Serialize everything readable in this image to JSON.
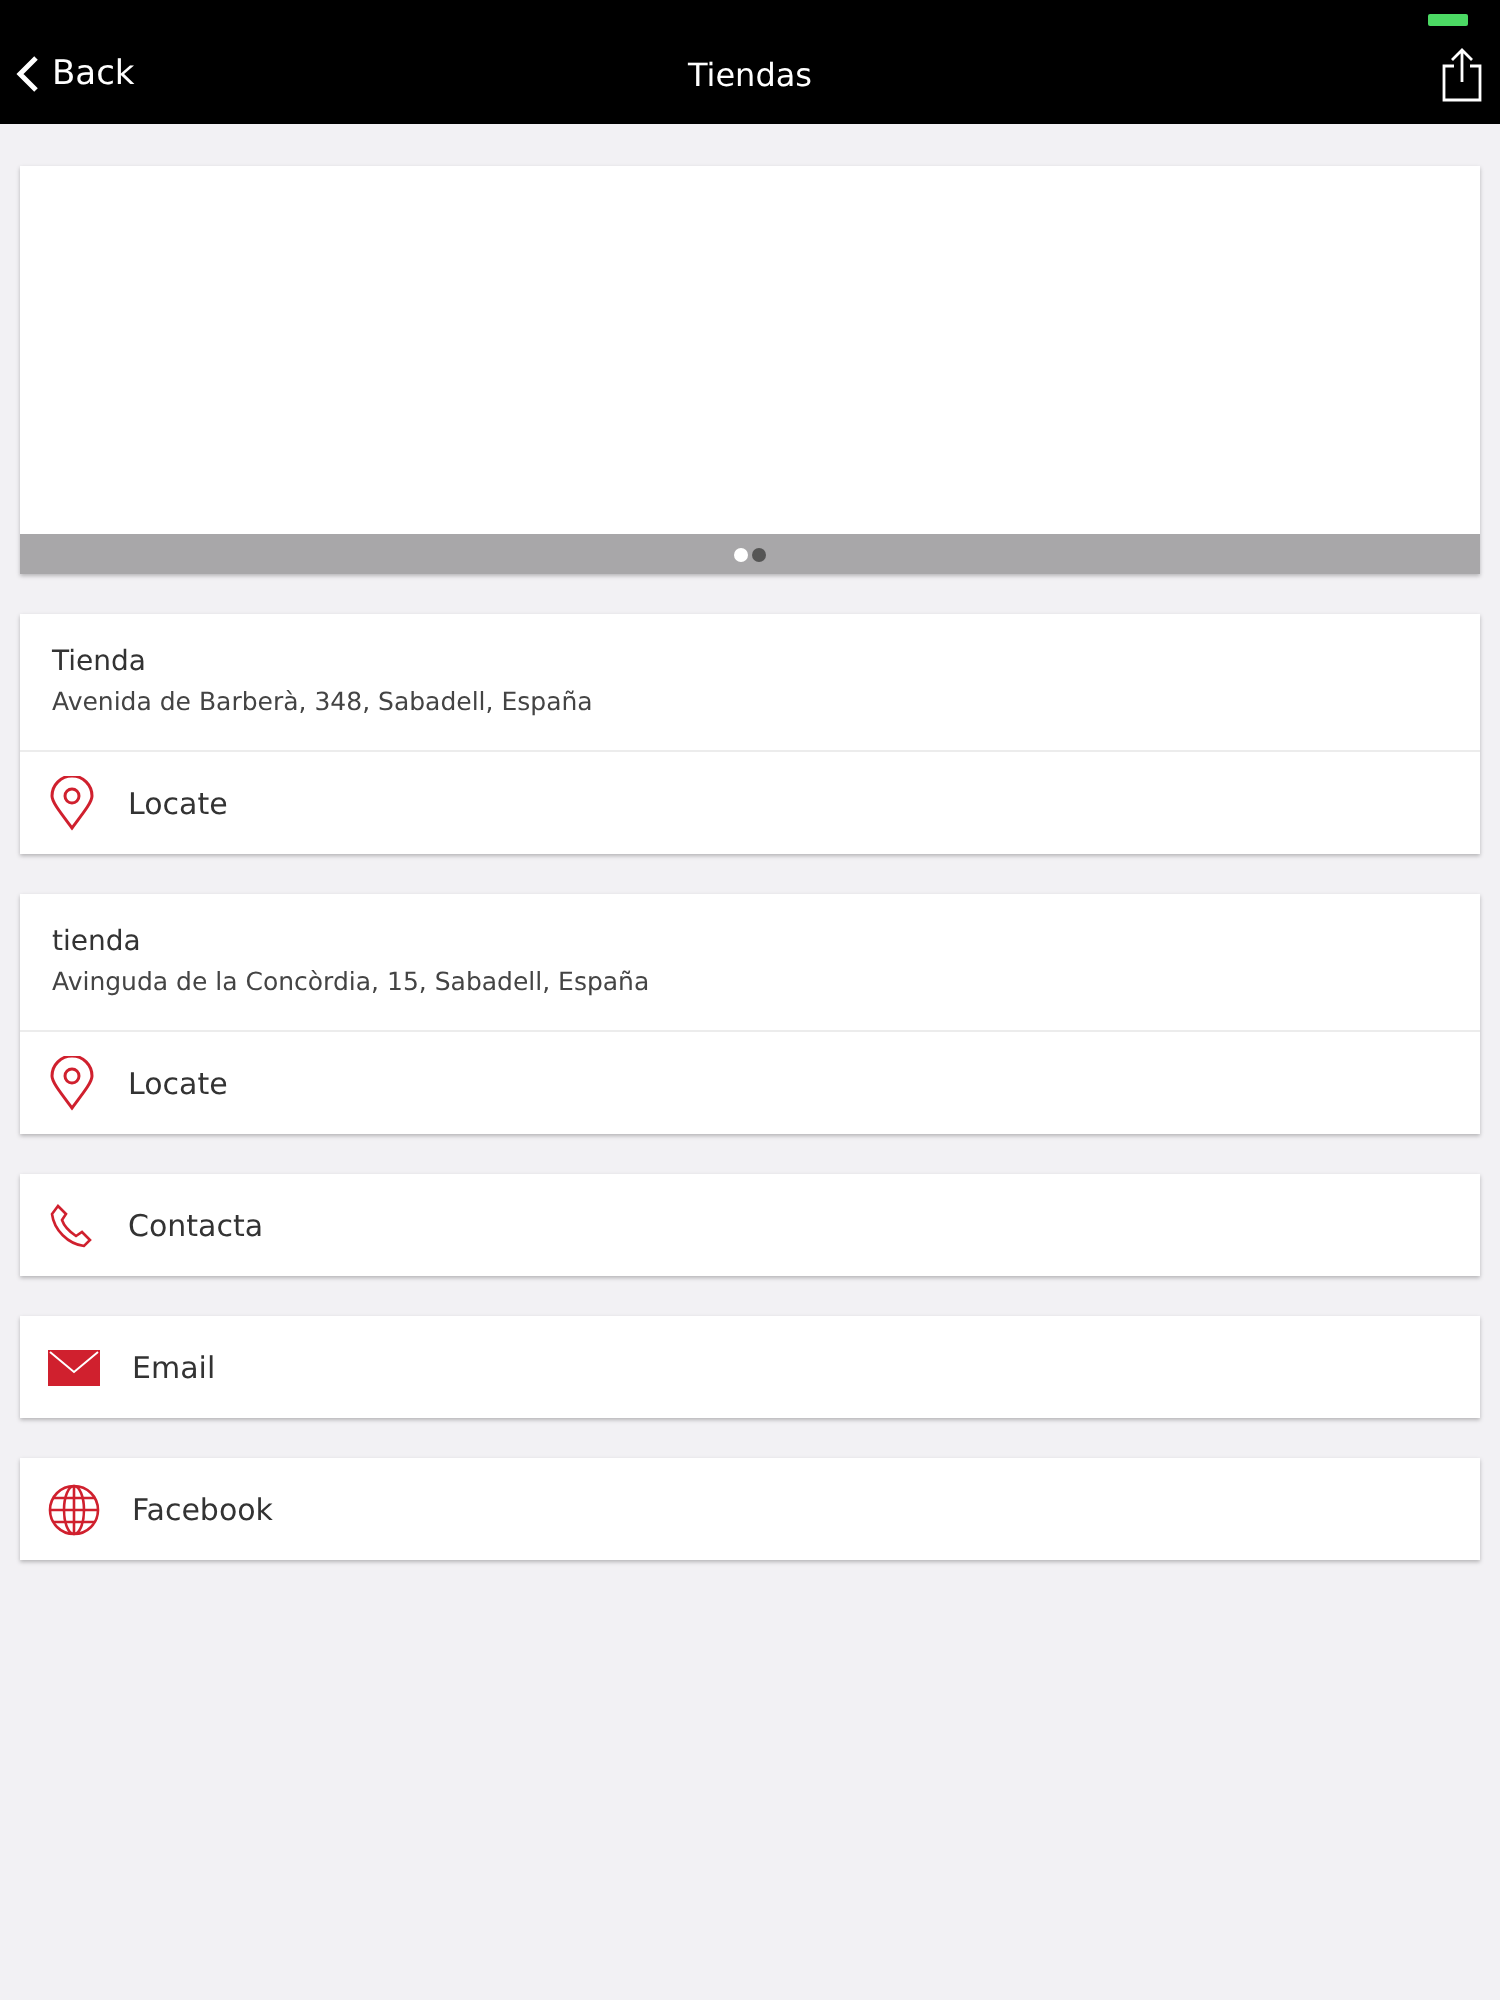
{
  "nav_bar": {
    "back_label": "Back",
    "title": "Tiendas"
  },
  "gallery": {
    "dots": [
      {
        "selected": true
      },
      {
        "selected": false
      }
    ]
  },
  "stores": [
    {
      "name": "Tienda",
      "address": "Avenida de Barberà, 348, Sabadell, España",
      "action": "Locate"
    },
    {
      "name": "tienda",
      "address": "Avinguda de la Concòrdia, 15, Sabadell, España",
      "action": "Locate"
    }
  ],
  "actions": [
    {
      "kind": "phone",
      "label": "Contacta"
    },
    {
      "kind": "email",
      "label": "Email"
    },
    {
      "kind": "globe",
      "label": "Facebook"
    }
  ]
}
